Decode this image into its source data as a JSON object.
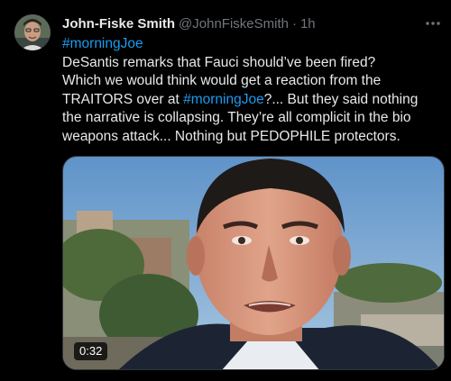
{
  "tweet": {
    "author": {
      "display_name": "John-Fiske Smith",
      "handle": "@JohnFiskeSmith",
      "avatar_icon": "avatar-photo"
    },
    "separator": "·",
    "time": "1h",
    "more_icon": "more-dots-icon",
    "text": {
      "hashtag_top": "#morningJoe",
      "line1": "DeSantis remarks that Fauci should’ve been fired?",
      "line2": "Which we would think would get a reaction from the",
      "line3_before": "TRAITORS over at ",
      "line3_hashtag": "#morningJoe",
      "line3_after": "?... But they said nothing",
      "line4": "the narrative is collapsing. They’re all complicit in the bio",
      "line5": "weapons attack... Nothing but PEDOPHILE protectors."
    },
    "media": {
      "type": "video",
      "duration": "0:32"
    },
    "colors": {
      "background": "#000000",
      "text": "#e7e9ea",
      "secondary": "#71767b",
      "link": "#1d9bf0"
    }
  }
}
